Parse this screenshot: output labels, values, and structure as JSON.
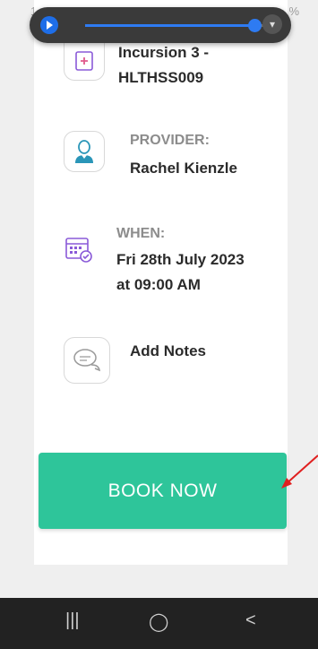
{
  "status_bar": {
    "time": "1:4",
    "right_text": "▾ ◢ 69%"
  },
  "media_control": {
    "progress": 0.92
  },
  "service": {
    "name_line1": "Incursion 3 -",
    "name_line2": "HLTHSS009"
  },
  "provider": {
    "label": "PROVIDER:",
    "value": "Rachel Kienzle"
  },
  "when": {
    "label": "WHEN:",
    "date": "Fri 28th July 2023",
    "time": "at 09:00 AM"
  },
  "notes": {
    "label": "Add Notes"
  },
  "book_button": {
    "label": "BOOK NOW"
  },
  "nav": {
    "recents": "|||",
    "home": "◯",
    "back": "<"
  },
  "colors": {
    "accent": "#2ec59a",
    "purple": "#8a5ad8",
    "teal": "#2a96b8",
    "arrow": "#e02020"
  }
}
